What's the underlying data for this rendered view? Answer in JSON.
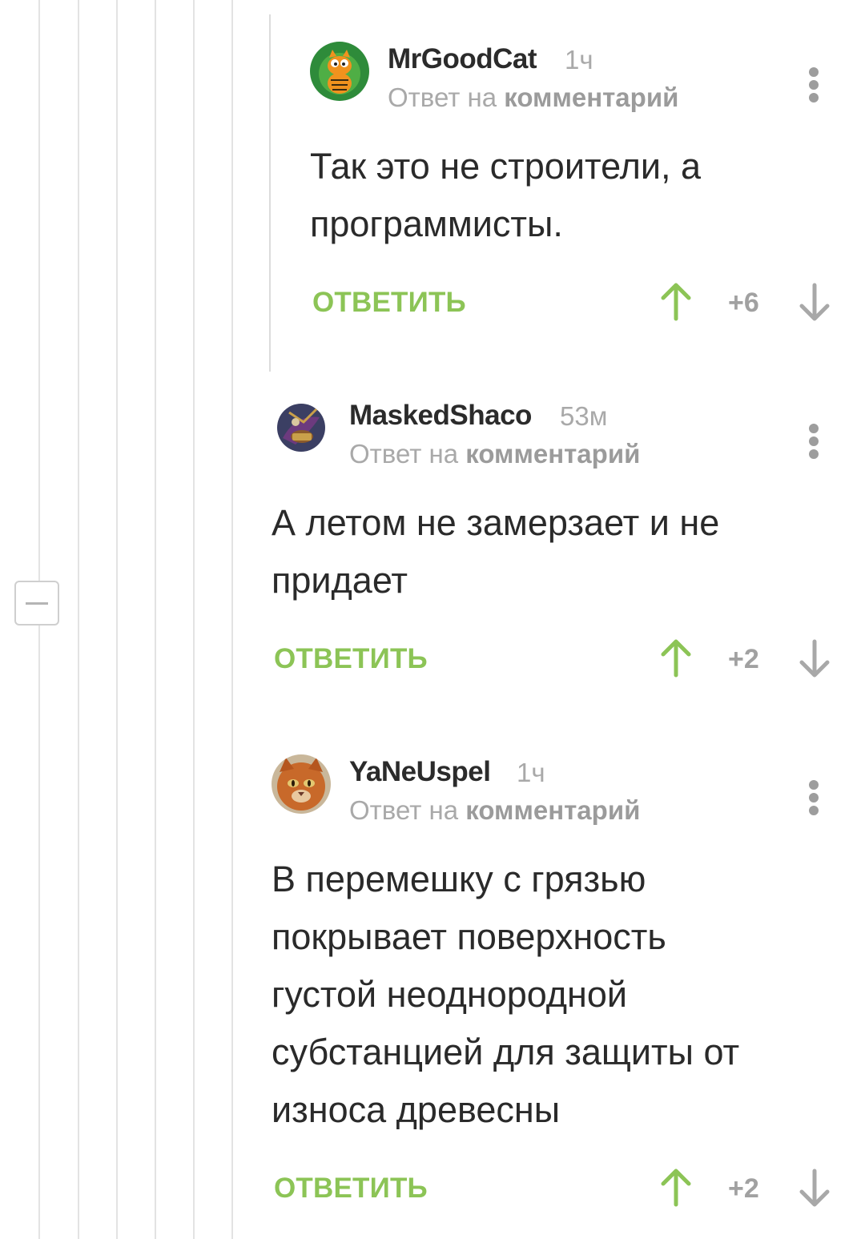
{
  "thread": {
    "collapse_label": "−"
  },
  "comments": [
    {
      "author": "MrGoodCat",
      "time": "1ч",
      "reply_prefix": "Ответ на ",
      "reply_link": "комментарий",
      "text_lines": [
        "Так это не строители, а",
        "программисты."
      ],
      "reply_label": "ОТВЕТИТЬ",
      "score": "+6",
      "avatar": "garfield-avatar"
    },
    {
      "author": "MaskedShaco",
      "time": "53м",
      "reply_prefix": "Ответ на ",
      "reply_link": "комментарий",
      "text_lines": [
        "А летом не замерзает и не",
        "придает"
      ],
      "reply_label": "ОТВЕТИТЬ",
      "score": "+2",
      "avatar": "league-of-legends-avatar"
    },
    {
      "author": "YaNeUspel",
      "time": "1ч",
      "reply_prefix": "Ответ на ",
      "reply_link": "комментарий",
      "text_lines": [
        "В перемешку с грязью",
        "покрывает поверхность",
        "густой неоднородной",
        "субстанцией для защиты от",
        "износа древесны"
      ],
      "reply_label": "ОТВЕТИТЬ",
      "score": "+2",
      "avatar": "cat-avatar"
    }
  ],
  "colors": {
    "accent_green": "#8cc456",
    "upvote_green": "#8cc456",
    "muted_gray": "#a9a9a9",
    "text_dark": "#2a2a2a"
  },
  "icons": {
    "upvote": "arrow-up-icon",
    "downvote": "arrow-down-icon",
    "more": "more-vertical-icon",
    "collapse": "minus-icon"
  }
}
